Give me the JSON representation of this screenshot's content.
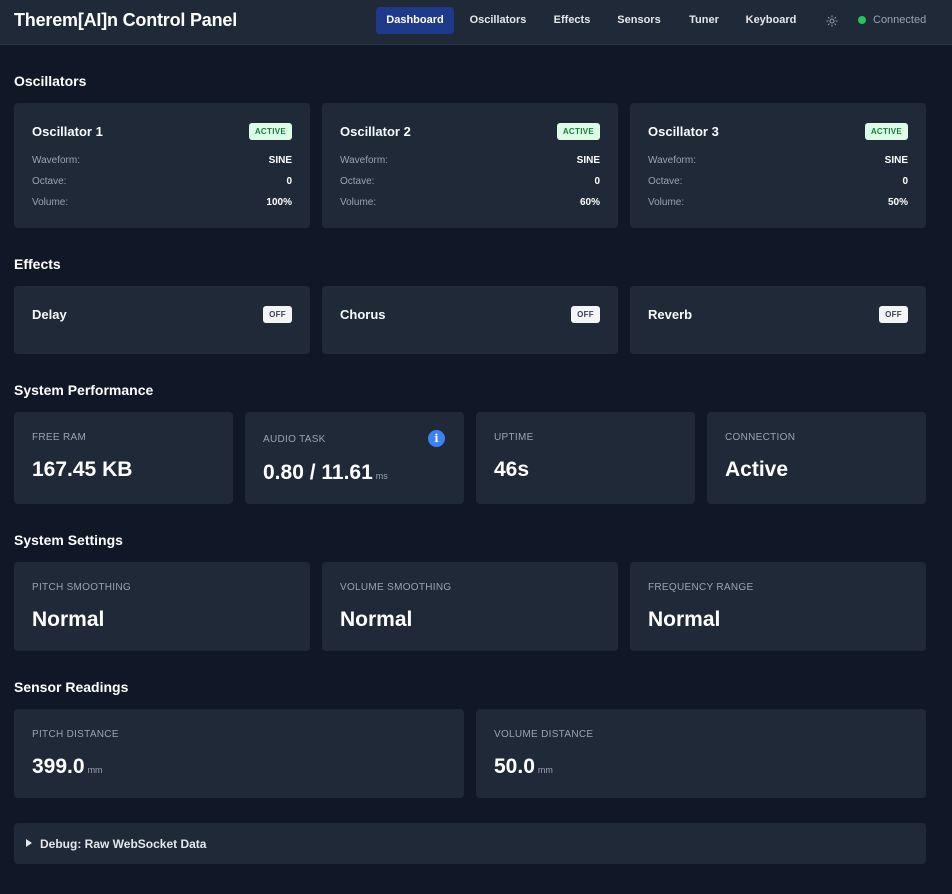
{
  "app": {
    "title": "Therem[AI]n Control Panel"
  },
  "nav": {
    "items": [
      {
        "label": "Dashboard",
        "active": true
      },
      {
        "label": "Oscillators"
      },
      {
        "label": "Effects"
      },
      {
        "label": "Sensors"
      },
      {
        "label": "Tuner"
      },
      {
        "label": "Keyboard"
      }
    ],
    "theme_icon": "sun-icon",
    "status_text": "Connected",
    "status_color": "#22c55e"
  },
  "oscillators": {
    "title": "Oscillators",
    "labels": {
      "waveform": "Waveform:",
      "octave": "Octave:",
      "volume": "Volume:"
    },
    "items": [
      {
        "name": "Oscillator 1",
        "badge": "ACTIVE",
        "waveform": "SINE",
        "octave": "0",
        "volume": "100%"
      },
      {
        "name": "Oscillator 2",
        "badge": "ACTIVE",
        "waveform": "SINE",
        "octave": "0",
        "volume": "60%"
      },
      {
        "name": "Oscillator 3",
        "badge": "ACTIVE",
        "waveform": "SINE",
        "octave": "0",
        "volume": "50%"
      }
    ]
  },
  "effects": {
    "title": "Effects",
    "items": [
      {
        "name": "Delay",
        "badge": "OFF"
      },
      {
        "name": "Chorus",
        "badge": "OFF"
      },
      {
        "name": "Reverb",
        "badge": "OFF"
      }
    ]
  },
  "performance": {
    "title": "System Performance",
    "free_ram": {
      "label": "FREE RAM",
      "value": "167.45 KB"
    },
    "audio_task": {
      "label": "AUDIO TASK",
      "value": "0.80 / 11.61",
      "unit": "ms",
      "info_icon": "i"
    },
    "uptime": {
      "label": "UPTIME",
      "value": "46s"
    },
    "connection": {
      "label": "CONNECTION",
      "value": "Active"
    }
  },
  "settings": {
    "title": "System Settings",
    "items": [
      {
        "label": "PITCH SMOOTHING",
        "value": "Normal"
      },
      {
        "label": "VOLUME SMOOTHING",
        "value": "Normal"
      },
      {
        "label": "FREQUENCY RANGE",
        "value": "Normal"
      }
    ]
  },
  "sensors": {
    "title": "Sensor Readings",
    "pitch": {
      "label": "PITCH DISTANCE",
      "value": "399.0",
      "unit": "mm"
    },
    "volume": {
      "label": "VOLUME DISTANCE",
      "value": "50.0",
      "unit": "mm"
    }
  },
  "debug": {
    "label": "Debug: Raw WebSocket Data"
  }
}
